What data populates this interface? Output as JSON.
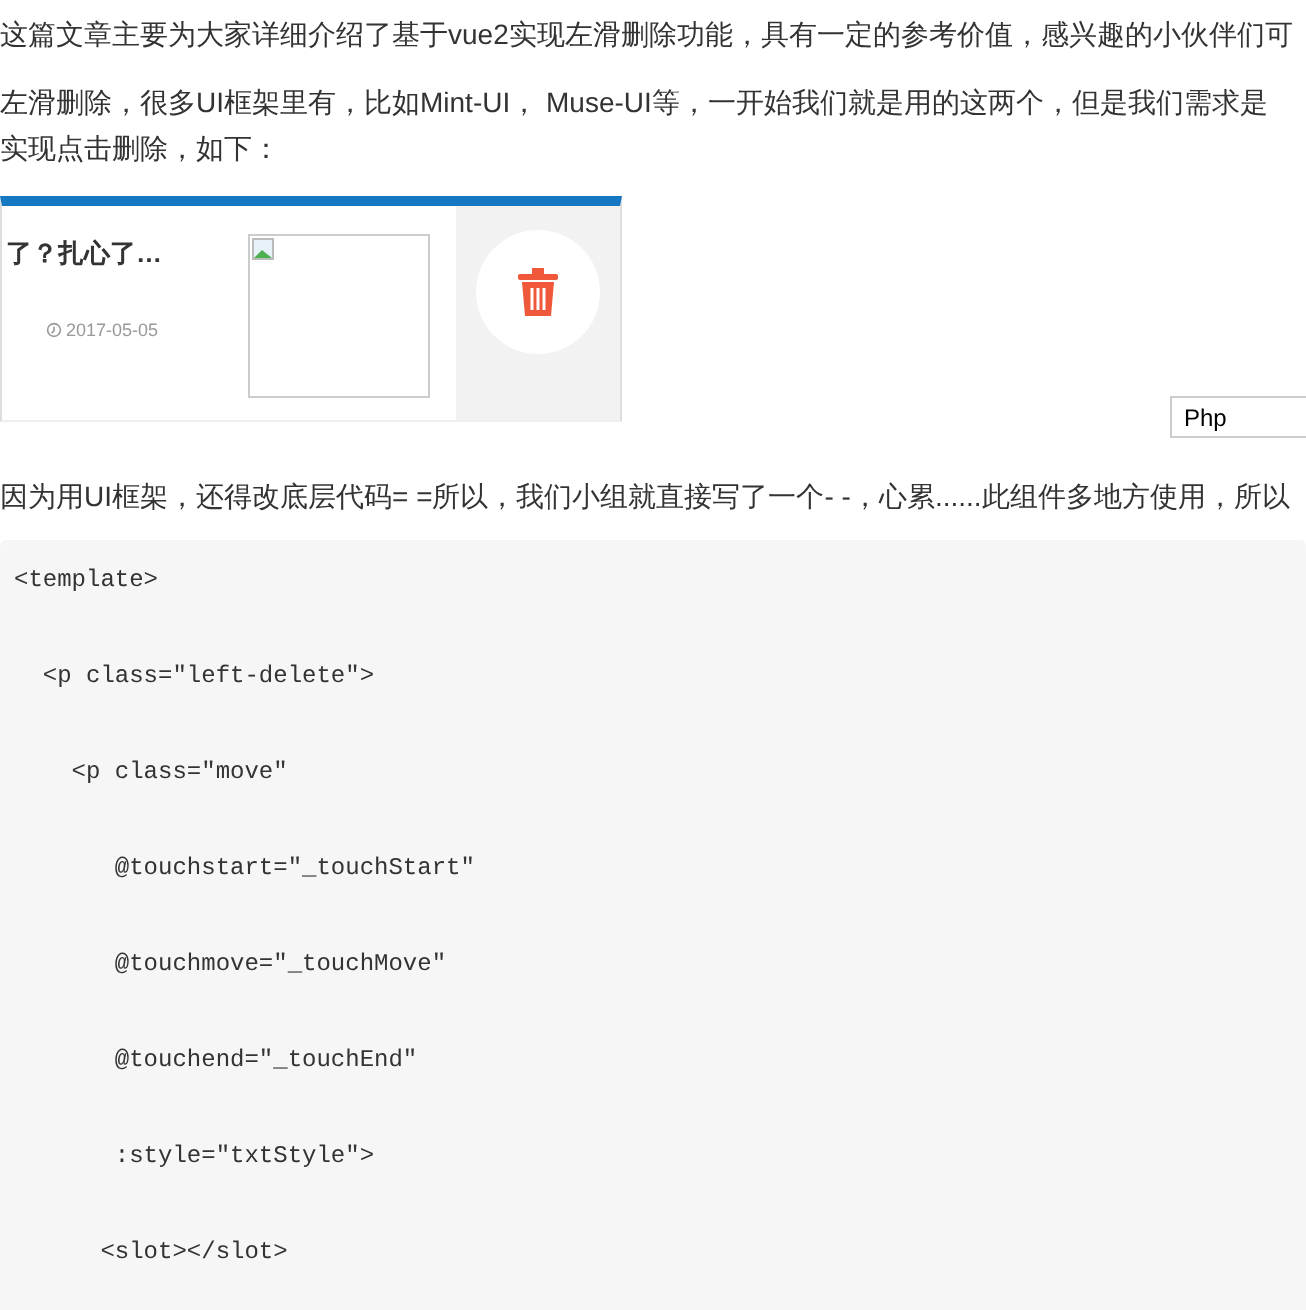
{
  "intro": "这篇文章主要为大家详细介绍了基于vue2实现左滑删除功能，具有一定的参考价值，感兴趣的小伙伴们可",
  "paragraph": [
    "左滑删除，很多UI框架里有，比如Mint-UI， Muse-UI等，一开始我们就是用的这两个，但是我们需求是",
    "实现点击删除，如下："
  ],
  "demo": {
    "title": "了？扎心了…",
    "date": "2017-05-05"
  },
  "language_field": {
    "value": "Php"
  },
  "note": "因为用UI框架，还得改底层代码= =所以，我们小组就直接写了一个- -，心累......此组件多地方使用，所以",
  "code_lines": [
    "<template>",
    "  <p class=″left-delete″>",
    "    <p class=″move″",
    "       @touchstart=″_touchStart″",
    "       @touchmove=″_touchMove″",
    "       @touchend=″_touchEnd″",
    "       :style=″txtStyle″>",
    "      <slot></slot>"
  ]
}
